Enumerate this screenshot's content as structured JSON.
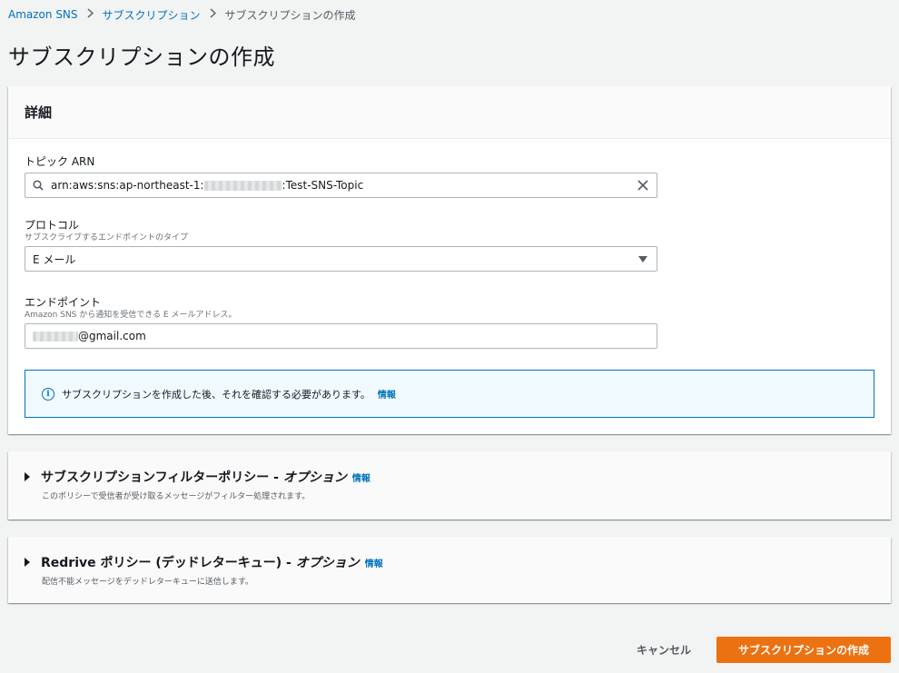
{
  "breadcrumb": {
    "items": [
      "Amazon SNS",
      "サブスクリプション"
    ],
    "current": "サブスクリプションの作成"
  },
  "page": {
    "title": "サブスクリプションの作成"
  },
  "details": {
    "heading": "詳細",
    "topic_arn": {
      "label": "トピック ARN",
      "value_prefix": "arn:aws:sns:ap-northeast-1:",
      "value_suffix": ":Test-SNS-Topic"
    },
    "protocol": {
      "label": "プロトコル",
      "description": "サブスクライブするエンドポイントのタイプ",
      "selected": "E メール"
    },
    "endpoint": {
      "label": "エンドポイント",
      "description": "Amazon SNS から通知を受信できる E メールアドレス。",
      "value_suffix": "@gmail.com"
    },
    "alert": {
      "message": "サブスクリプションを作成した後、それを確認する必要があります。",
      "link": "情報"
    }
  },
  "filter_policy": {
    "title": "サブスクリプションフィルターポリシー - ",
    "optional": "オプション",
    "link": "情報",
    "description": "このポリシーで受信者が受け取るメッセージがフィルター処理されます。"
  },
  "redrive_policy": {
    "title": "Redrive ポリシー (デッドレターキュー) - ",
    "optional": "オプション",
    "link": "情報",
    "description": "配信不能メッセージをデッドレターキューに送信します。"
  },
  "actions": {
    "cancel": "キャンセル",
    "create": "サブスクリプションの作成"
  },
  "colors": {
    "primary_button": "#ec7211",
    "link": "#0073bb",
    "alert_bg": "#f1faff"
  }
}
